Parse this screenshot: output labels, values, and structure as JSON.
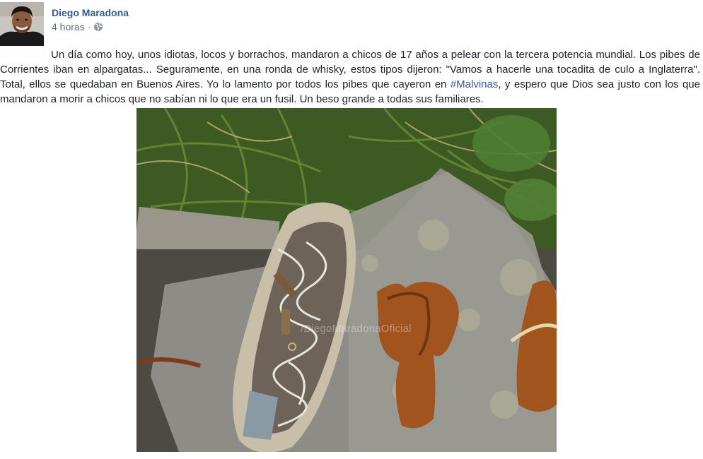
{
  "post": {
    "author_name": "Diego Maradona",
    "timestamp": "4 horas",
    "separator": "·",
    "privacy_icon": "globe-icon",
    "text_before_hashtag": "Un día como hoy, unos idiotas, locos y borrachos, mandaron a chicos de 17 años a pelear con la tercera potencia mundial. Los pibes de Corrientes iban en alpargatas... Seguramente, en una ronda de whisky, estos tipos dijeron: \"Vamos a hacerle una tocadita de culo a Inglaterra\". Total, ellos se quedaban en Buenos Aires. Yo lo lamento por todos los pibes que cayeron en ",
    "hashtag": "#Malvinas",
    "text_after_hashtag": ", y espero que Dios sea justo con los que mandaron a morir a chicos que no sabían ni lo que era un fusil. Un beso grande a todas sus familiares.",
    "photo": {
      "watermark": "/DiegoMaradonaOficial"
    }
  },
  "colors": {
    "link": "#365899",
    "meta": "#616770",
    "text": "#1d2129"
  }
}
